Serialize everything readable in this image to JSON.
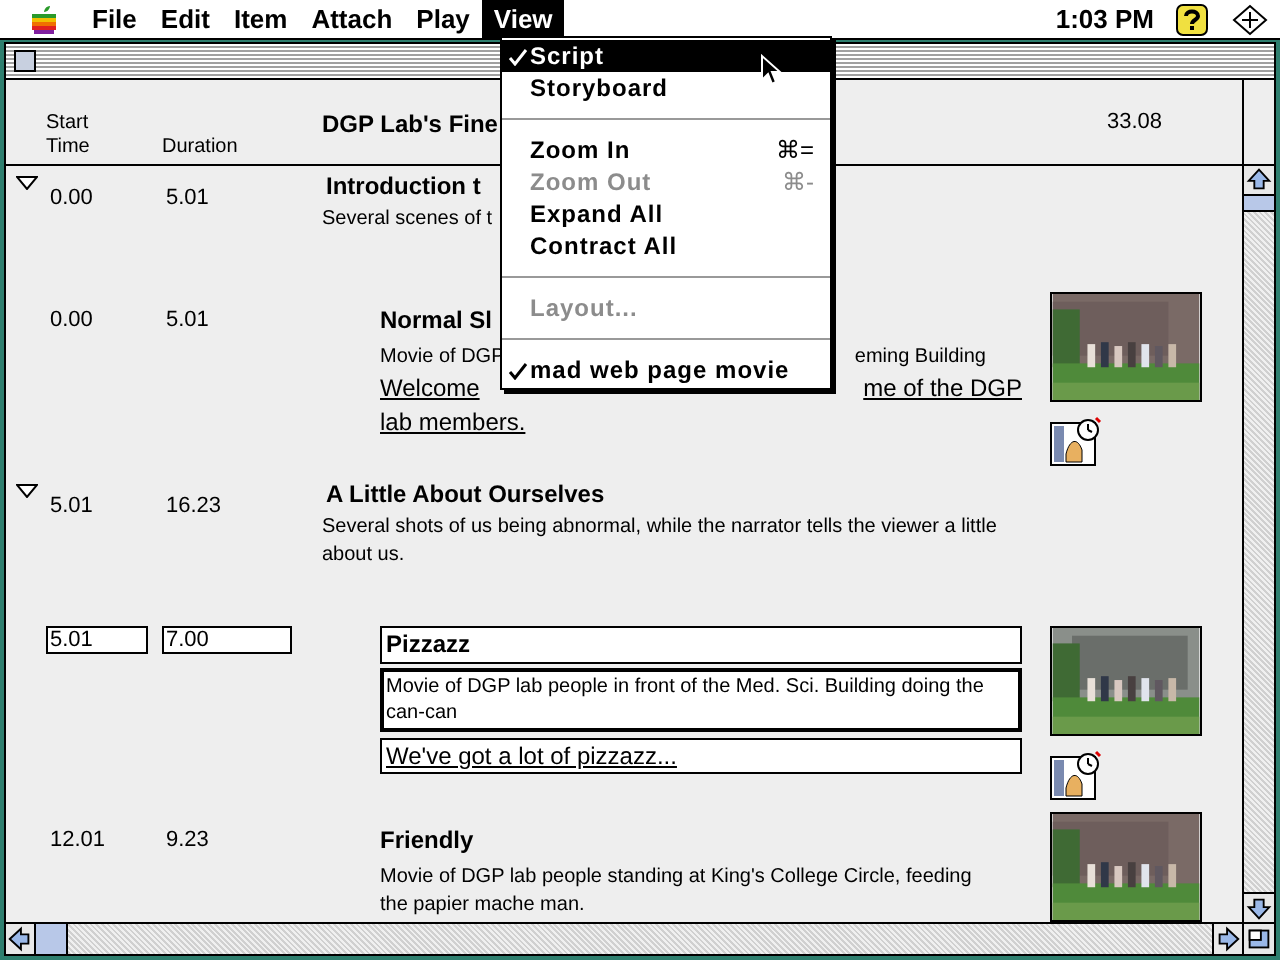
{
  "menubar": {
    "items": [
      {
        "label": "File",
        "selected": false
      },
      {
        "label": "Edit",
        "selected": false
      },
      {
        "label": "Item",
        "selected": false
      },
      {
        "label": "Attach",
        "selected": false
      },
      {
        "label": "Play",
        "selected": false
      },
      {
        "label": "View",
        "selected": true
      }
    ],
    "clock": "1:03 PM"
  },
  "header": {
    "start_label": "Start",
    "time_label": "Time",
    "duration_label": "Duration",
    "title": "DGP Lab's Fine",
    "total": "33.08"
  },
  "rows": [
    {
      "kind": "sequence",
      "expanded": true,
      "start": "0.00",
      "duration": "5.01",
      "title": "Introduction t",
      "description": [
        "Several scenes of t"
      ]
    },
    {
      "kind": "clip",
      "editing": false,
      "start": "0.00",
      "duration": "5.01",
      "title": "Normal Sl",
      "description": [
        "Movie of DGP",
        "eming Building"
      ],
      "narration": [
        [
          "Welcome",
          "me of the DGP"
        ],
        [
          "lab members."
        ]
      ]
    },
    {
      "kind": "sequence",
      "expanded": true,
      "start": "5.01",
      "duration": "16.23",
      "title": "A Little About Ourselves",
      "description": [
        "Several shots of us being abnormal, while the narrator tells the viewer a little about us."
      ]
    },
    {
      "kind": "clip",
      "editing": true,
      "start": "5.01",
      "duration": "7.00",
      "title": "Pizzazz",
      "description": [
        "Movie of DGP lab people in front of the Med. Sci. Building doing the can-can"
      ],
      "narration": [
        [
          "We've got a lot of pizzazz..."
        ]
      ]
    },
    {
      "kind": "clip",
      "editing": false,
      "start": "12.01",
      "duration": "9.23",
      "title": "Friendly",
      "description": [
        "Movie of DGP lab people standing at King's College Circle, feeding the papier mache man."
      ]
    }
  ],
  "menu": {
    "items": [
      {
        "kind": "item",
        "label": "Script",
        "checked": true,
        "disabled": false,
        "selected": true
      },
      {
        "kind": "item",
        "label": "Storyboard",
        "checked": false,
        "disabled": false,
        "selected": false
      },
      {
        "kind": "separator"
      },
      {
        "kind": "item",
        "label": "Zoom In",
        "shortcut": "⌘=",
        "checked": false,
        "disabled": false,
        "selected": false
      },
      {
        "kind": "item",
        "label": "Zoom Out",
        "shortcut": "⌘-",
        "checked": false,
        "disabled": true,
        "selected": false
      },
      {
        "kind": "item",
        "label": "Expand All",
        "checked": false,
        "disabled": false,
        "selected": false
      },
      {
        "kind": "item",
        "label": "Contract All",
        "checked": false,
        "disabled": false,
        "selected": false
      },
      {
        "kind": "separator"
      },
      {
        "kind": "item",
        "label": "Layout...",
        "checked": false,
        "disabled": true,
        "selected": false
      },
      {
        "kind": "separator"
      },
      {
        "kind": "item",
        "label": "mad web page movie",
        "checked": true,
        "disabled": false,
        "selected": false
      }
    ]
  }
}
